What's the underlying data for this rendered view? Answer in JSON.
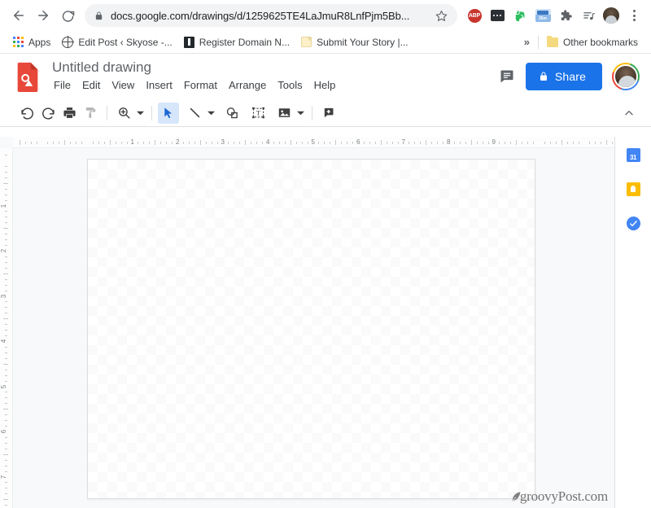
{
  "browser": {
    "nav": {
      "back": "back-arrow",
      "forward": "forward-arrow",
      "reload": "reload"
    },
    "omnibox": {
      "url": "docs.google.com/drawings/d/1259625TE4LaJmuR8LnfPjm5Bb...",
      "lock_icon": "lock-icon",
      "star_icon": "star-icon"
    },
    "extensions": [
      {
        "name": "adblock-plus",
        "label": "ABP",
        "color": "#c9342c"
      },
      {
        "name": "dots-extension",
        "label": "",
        "color": "#2b3034"
      },
      {
        "name": "evernote",
        "label": "",
        "color": "#2dbe60"
      },
      {
        "name": "screen-capture",
        "label": "35m",
        "color": "#3b78c4"
      },
      {
        "name": "extensions-puzzle",
        "label": "",
        "color": "#5f6368"
      },
      {
        "name": "media-control",
        "label": "",
        "color": "#5f6368"
      },
      {
        "name": "profile-avatar",
        "label": "",
        "color": "#44382c"
      },
      {
        "name": "chrome-menu",
        "label": "",
        "color": "#5f6368"
      }
    ],
    "bookmarks": {
      "items": [
        {
          "label": "Apps",
          "icon": "apps-grid-icon"
        },
        {
          "label": "Edit Post ‹ Skyose -...",
          "icon": "globe-icon"
        },
        {
          "label": "Register Domain N...",
          "icon": "dark-square-icon"
        },
        {
          "label": "Submit Your Story |...",
          "icon": "page-icon"
        }
      ],
      "overflow": "»",
      "other": {
        "label": "Other bookmarks",
        "icon": "folder-icon"
      }
    }
  },
  "docs": {
    "title": "Untitled drawing",
    "logo_icon": "google-drawings-logo",
    "menus": [
      "File",
      "Edit",
      "View",
      "Insert",
      "Format",
      "Arrange",
      "Tools",
      "Help"
    ],
    "comment_icon": "comment-icon",
    "share": {
      "label": "Share",
      "icon": "lock-icon",
      "color": "#1a73e8"
    },
    "profile_icon": "account-avatar"
  },
  "toolbar": {
    "buttons": [
      {
        "name": "undo",
        "icon": "undo-icon",
        "state": "enabled"
      },
      {
        "name": "redo",
        "icon": "redo-icon",
        "state": "enabled"
      },
      {
        "name": "print",
        "icon": "print-icon",
        "state": "enabled"
      },
      {
        "name": "paint-format",
        "icon": "paint-format-icon",
        "state": "disabled"
      },
      {
        "name": "zoom",
        "icon": "zoom-in-icon",
        "state": "enabled",
        "has_caret": true
      },
      {
        "name": "select",
        "icon": "cursor-arrow-icon",
        "state": "active"
      },
      {
        "name": "line",
        "icon": "line-icon",
        "state": "enabled",
        "has_caret": true
      },
      {
        "name": "shape",
        "icon": "shape-icon",
        "state": "enabled"
      },
      {
        "name": "text-box",
        "icon": "text-box-icon",
        "state": "enabled"
      },
      {
        "name": "image",
        "icon": "image-icon",
        "state": "enabled",
        "has_caret": true
      },
      {
        "name": "add-comment",
        "icon": "add-comment-icon",
        "state": "enabled"
      }
    ],
    "collapse_icon": "chevron-up-icon"
  },
  "workspace": {
    "ruler_h": {
      "numbers": [
        1,
        2,
        3,
        4,
        5,
        6,
        7,
        8,
        9
      ]
    },
    "ruler_v": {
      "numbers": [
        1,
        2,
        3,
        4,
        5,
        6,
        7
      ]
    },
    "canvas": {
      "name": "drawing-canvas",
      "background": "transparent-checkerboard"
    }
  },
  "sidepanel": {
    "items": [
      {
        "name": "google-calendar",
        "icon": "calendar-icon",
        "label": "31",
        "color": "#4285f4"
      },
      {
        "name": "google-keep",
        "icon": "keep-bulb-icon",
        "label": "",
        "color": "#fbbc04"
      },
      {
        "name": "google-tasks",
        "icon": "tasks-check-icon",
        "label": "",
        "color": "#4285f4"
      }
    ]
  },
  "watermark": {
    "text": "groovyPost.com",
    "icon": "quill-icon"
  }
}
